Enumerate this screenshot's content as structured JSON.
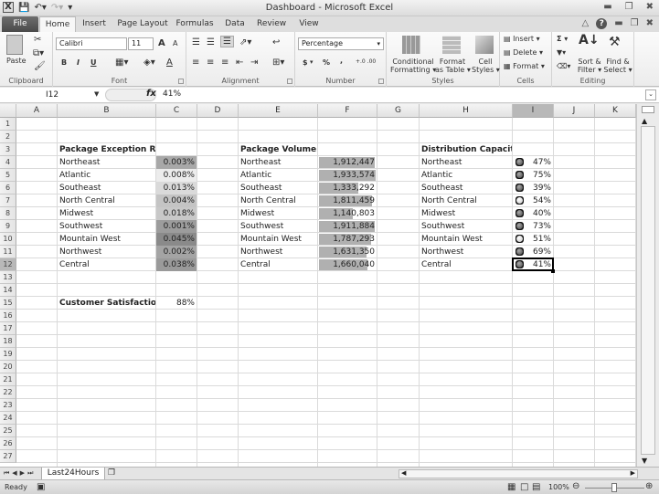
{
  "window": {
    "title": "Dashboard - Microsoft Excel",
    "minimize_icon": "minimize-icon",
    "restore_icon": "restore-icon",
    "close_icon": "close-icon"
  },
  "qat": {
    "app_icon": "X",
    "save_icon": "save-icon",
    "undo_icon": "undo-icon",
    "redo_icon": "redo-icon",
    "customize_icon": "customize-icon"
  },
  "tabs": [
    "File",
    "Home",
    "Insert",
    "Page Layout",
    "Formulas",
    "Data",
    "Review",
    "View"
  ],
  "active_tab": "Home",
  "ribbon": {
    "clipboard": {
      "label": "Clipboard",
      "paste": "Paste"
    },
    "font": {
      "label": "Font",
      "font_name": "Calibri",
      "font_size": "11",
      "bold": "B",
      "italic": "I",
      "underline": "U",
      "grow": "A",
      "shrink": "A",
      "color": "A"
    },
    "alignment": {
      "label": "Alignment"
    },
    "number": {
      "label": "Number",
      "format": "Percentage",
      "currency": "$",
      "percent": "%",
      "comma": ",",
      "inc_decimal": "+.0 .00",
      "dec_decimal": ".00 +.0"
    },
    "styles": {
      "label": "Styles",
      "conditional_formatting": [
        "Conditional",
        "Formatting ▾"
      ],
      "format_as_table": [
        "Format",
        "as Table ▾"
      ],
      "cell_styles": [
        "Cell",
        "Styles ▾"
      ]
    },
    "cells": {
      "label": "Cells",
      "insert": "Insert ▾",
      "delete": "Delete ▾",
      "format": "Format ▾"
    },
    "editing": {
      "label": "Editing",
      "sum": "Σ ▾",
      "sort_filter": [
        "Sort &",
        "Filter ▾"
      ],
      "find_select": [
        "Find &",
        "Select ▾"
      ]
    }
  },
  "formula_bar": {
    "name_box": "I12",
    "fx": "fx",
    "value": "41%"
  },
  "columns": [
    "A",
    "B",
    "C",
    "D",
    "E",
    "F",
    "G",
    "H",
    "I",
    "J",
    "K"
  ],
  "selected_column": "I",
  "rows": [
    "1",
    "2",
    "3",
    "4",
    "5",
    "6",
    "7",
    "8",
    "9",
    "10",
    "11",
    "12",
    "13",
    "14",
    "15",
    "16",
    "17",
    "18",
    "19",
    "20",
    "21",
    "22",
    "23",
    "24",
    "25",
    "26",
    "27"
  ],
  "selected_row": "12",
  "exception_rate": {
    "title": "Package Exception Rate",
    "items": [
      {
        "region": "Northeast",
        "value": "0.003%",
        "shade": "#a8a8a8"
      },
      {
        "region": "Atlantic",
        "value": "0.008%",
        "shade": "#ececec"
      },
      {
        "region": "Southeast",
        "value": "0.013%",
        "shade": "#dadada"
      },
      {
        "region": "North Central",
        "value": "0.004%",
        "shade": "#c4c4c4"
      },
      {
        "region": "Midwest",
        "value": "0.018%",
        "shade": "#c8c8c8"
      },
      {
        "region": "Southwest",
        "value": "0.001%",
        "shade": "#9c9c9c"
      },
      {
        "region": "Mountain West",
        "value": "0.045%",
        "shade": "#8a8a8a"
      },
      {
        "region": "Northwest",
        "value": "0.002%",
        "shade": "#a4a4a4"
      },
      {
        "region": "Central",
        "value": "0.038%",
        "shade": "#9a9a9a"
      }
    ]
  },
  "package_volume": {
    "title": "Package Volume",
    "max": 1933574,
    "items": [
      {
        "region": "Northeast",
        "value": "1,912,447",
        "num": 1912447
      },
      {
        "region": "Atlantic",
        "value": "1,933,574",
        "num": 1933574
      },
      {
        "region": "Southeast",
        "value": "1,333,292",
        "num": 1333292
      },
      {
        "region": "North Central",
        "value": "1,811,459",
        "num": 1811459
      },
      {
        "region": "Midwest",
        "value": "1,140,803",
        "num": 1140803
      },
      {
        "region": "Southwest",
        "value": "1,911,884",
        "num": 1911884
      },
      {
        "region": "Mountain West",
        "value": "1,787,293",
        "num": 1787293
      },
      {
        "region": "Northwest",
        "value": "1,631,350",
        "num": 1631350
      },
      {
        "region": "Central",
        "value": "1,660,040",
        "num": 1660040
      }
    ]
  },
  "distribution_capacity": {
    "title": "Distribution Capacity",
    "items": [
      {
        "region": "Northeast",
        "value": "47%",
        "light": "dark"
      },
      {
        "region": "Atlantic",
        "value": "75%",
        "light": "dark"
      },
      {
        "region": "Southeast",
        "value": "39%",
        "light": "dark"
      },
      {
        "region": "North Central",
        "value": "54%",
        "light": "light"
      },
      {
        "region": "Midwest",
        "value": "40%",
        "light": "dark"
      },
      {
        "region": "Southwest",
        "value": "73%",
        "light": "dark"
      },
      {
        "region": "Mountain West",
        "value": "51%",
        "light": "light"
      },
      {
        "region": "Northwest",
        "value": "69%",
        "light": "dark"
      },
      {
        "region": "Central",
        "value": "41%",
        "light": "dark"
      }
    ]
  },
  "customer_satisfaction": {
    "label": "Customer Satisfaction",
    "value": "88%"
  },
  "sheet_tabs": [
    "Last24Hours"
  ],
  "status": {
    "ready": "Ready",
    "zoom": "100%"
  }
}
